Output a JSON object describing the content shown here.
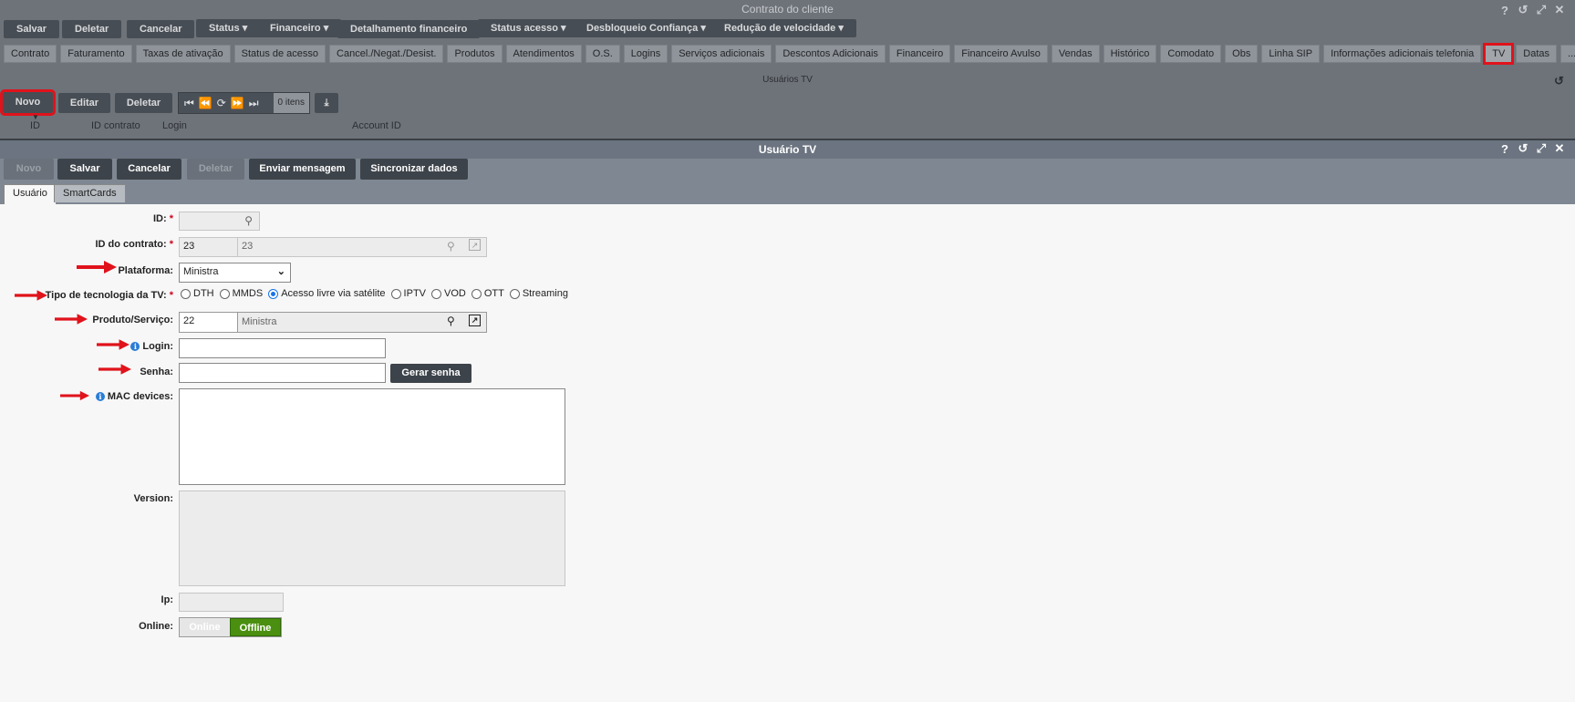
{
  "bg_window": {
    "title": "Contrato do cliente",
    "toolbar": {
      "save": "Salvar",
      "delete": "Deletar",
      "cancel": "Cancelar",
      "status": "Status",
      "financeiro": "Financeiro",
      "detalhamento": "Detalhamento financeiro",
      "status_acesso": "Status acesso",
      "desbloqueio": "Desbloqueio Confiança",
      "reducao": "Redução de velocidade"
    },
    "tabs": [
      "Contrato",
      "Faturamento",
      "Taxas de ativação",
      "Status de acesso",
      "Cancel./Negat./Desist.",
      "Produtos",
      "Atendimentos",
      "O.S.",
      "Logins",
      "Serviços adicionais",
      "Descontos Adicionais",
      "Financeiro",
      "Financeiro Avulso",
      "Vendas",
      "Histórico",
      "Comodato",
      "Obs",
      "Linha SIP",
      "Informações adicionais telefonia",
      "TV",
      "Datas",
      "..."
    ],
    "active_tab": "TV",
    "grid_title": "Usuários TV",
    "grid_buttons": {
      "new": "Novo",
      "edit": "Editar",
      "delete": "Deletar"
    },
    "pager_count": "0 itens",
    "columns": [
      "ID",
      "ID contrato",
      "Login",
      "Account ID"
    ]
  },
  "modal": {
    "title": "Usuário TV",
    "toolbar": {
      "new": "Novo",
      "save": "Salvar",
      "cancel": "Cancelar",
      "delete": "Deletar",
      "send_message": "Enviar mensagem",
      "sync": "Sincronizar dados"
    },
    "tabs": [
      "Usuário",
      "SmartCards"
    ],
    "form": {
      "id_label": "ID:",
      "id_value": "",
      "contract_label": "ID do contrato:",
      "contract_id": "23",
      "contract_desc": "23",
      "platform_label": "Plataforma:",
      "platform_value": "Ministra",
      "tech_label": "Tipo de tecnologia da TV:",
      "tech_options": [
        "DTH",
        "MMDS",
        "Acesso livre via satélite",
        "IPTV",
        "VOD",
        "OTT",
        "Streaming"
      ],
      "tech_selected": "Acesso livre via satélite",
      "product_label": "Produto/Serviço:",
      "product_id": "22",
      "product_desc": "Ministra",
      "login_label": "Login:",
      "login_value": "",
      "password_label": "Senha:",
      "password_value": "",
      "gen_password": "Gerar senha",
      "mac_label": "MAC devices:",
      "version_label": "Version:",
      "ip_label": "Ip:",
      "online_label": "Online:",
      "online_on": "Online",
      "online_off": "Offline",
      "required_mark": "*"
    }
  },
  "colors": {
    "annotation_red": "#e0121b",
    "offline_green": "#4b8f10",
    "info_blue": "#2a7dd6"
  }
}
